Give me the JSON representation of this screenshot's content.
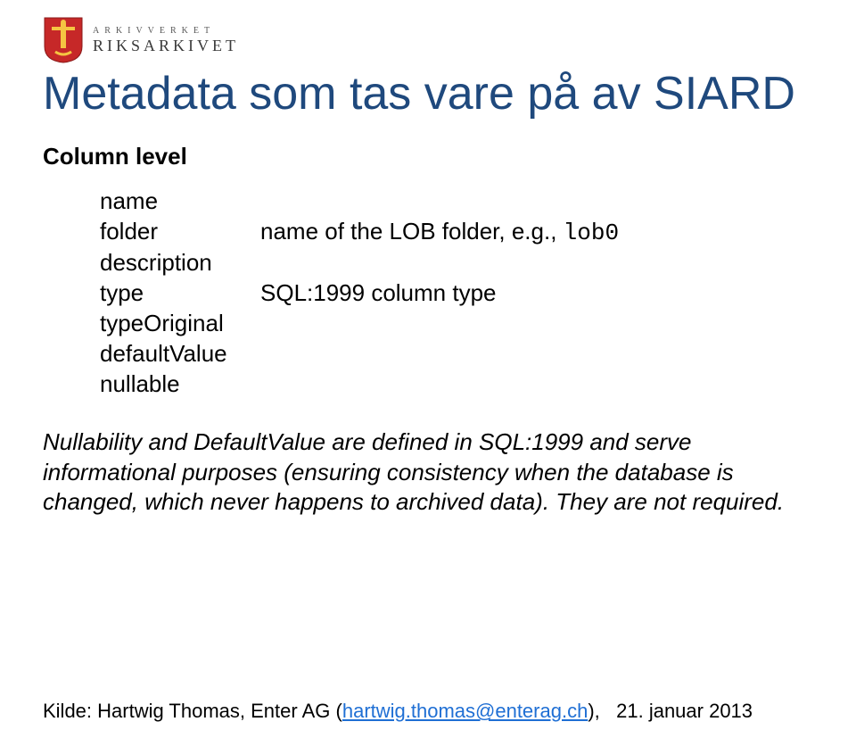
{
  "logo": {
    "line1": "ARKIVVERKET",
    "line2": "RIKSARKIVET"
  },
  "title": "Metadata som tas vare på av SIARD",
  "section_label": "Column level",
  "fields": {
    "name": {
      "label": "name",
      "desc": ""
    },
    "folder": {
      "label": "folder",
      "desc_prefix": "name of the LOB folder, e.g., ",
      "desc_code": "lob0"
    },
    "description": {
      "label": "description",
      "desc": ""
    },
    "type": {
      "label": "type",
      "desc": "SQL:1999 column type"
    },
    "typeOriginal": {
      "label": "typeOriginal",
      "desc": ""
    },
    "defaultValue": {
      "label": "defaultValue",
      "desc": ""
    },
    "nullable": {
      "label": "nullable",
      "desc": ""
    }
  },
  "note": "Nullability and DefaultValue are defined in SQL:1999 and serve informational purposes (ensuring consistency when the database is changed, which never happens to archived data). They are not required.",
  "source": {
    "prefix": "Kilde: Hartwig Thomas, Enter AG (",
    "email": "hartwig.thomas@enterag.ch",
    "middle": "),",
    "date": "21. januar 2013"
  }
}
